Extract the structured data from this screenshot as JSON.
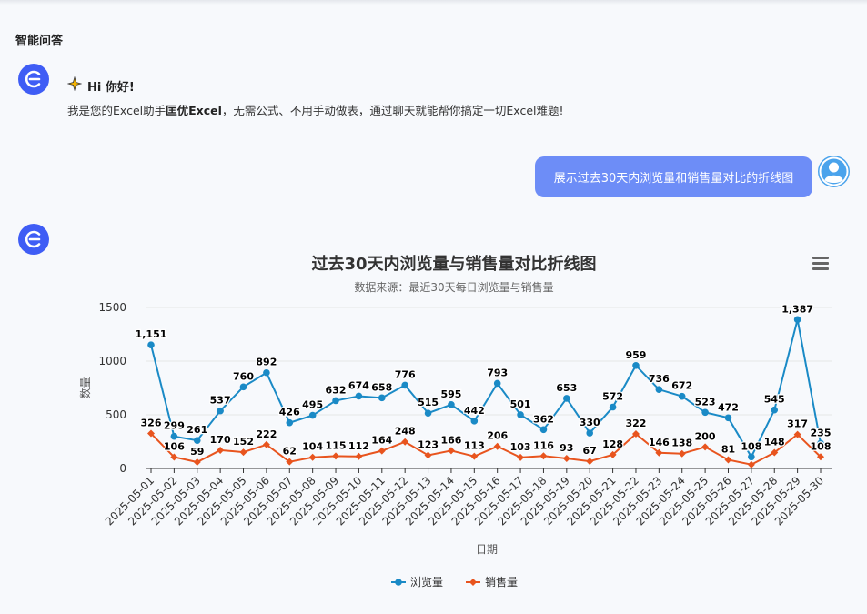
{
  "section": {
    "title": "智能问答"
  },
  "greeting": {
    "title": "Hi 你好!",
    "text_prefix": "我是您的Excel助手",
    "text_bold": "匡优Excel",
    "text_suffix": "，无需公式、不用手动做表，通过聊天就能帮你搞定一切Excel难题!"
  },
  "user_message": {
    "text": "展示过去30天内浏览量和销售量对比的折线图"
  },
  "colors": {
    "accent": "#3f5df5",
    "bubble": "#6d8df7",
    "series_views": "#1a8ac6",
    "series_sales": "#e8541e"
  },
  "chart_data": {
    "type": "line",
    "title": "过去30天内浏览量与销售量对比折线图",
    "subtitle": "数据来源：最近30天每日浏览量与销售量",
    "xlabel": "日期",
    "ylabel": "数量",
    "ylim": [
      0,
      1500
    ],
    "yticks": [
      "0",
      "500",
      "1000",
      "1500"
    ],
    "grid": true,
    "legend_position": "bottom-center",
    "categories": [
      "2025-05-01",
      "2025-05-02",
      "2025-05-03",
      "2025-05-04",
      "2025-05-05",
      "2025-05-06",
      "2025-05-07",
      "2025-05-08",
      "2025-05-09",
      "2025-05-10",
      "2025-05-11",
      "2025-05-12",
      "2025-05-13",
      "2025-05-14",
      "2025-05-15",
      "2025-05-16",
      "2025-05-17",
      "2025-05-18",
      "2025-05-19",
      "2025-05-20",
      "2025-05-21",
      "2025-05-22",
      "2025-05-23",
      "2025-05-24",
      "2025-05-25",
      "2025-05-26",
      "2025-05-27",
      "2025-05-28",
      "2025-05-29",
      "2025-05-30"
    ],
    "series": [
      {
        "name": "浏览量",
        "color": "#1a8ac6",
        "marker": "circle",
        "values": [
          1151,
          299,
          261,
          537,
          760,
          892,
          426,
          495,
          632,
          674,
          658,
          776,
          515,
          595,
          442,
          793,
          501,
          362,
          653,
          330,
          572,
          959,
          736,
          672,
          523,
          472,
          108,
          545,
          1387,
          235
        ],
        "labels": [
          "1,151",
          "299",
          "261",
          "537",
          "760",
          "892",
          "426",
          "495",
          "632",
          "674",
          "658",
          "776",
          "515",
          "595",
          "442",
          "793",
          "501",
          "362",
          "653",
          "330",
          "572",
          "959",
          "736",
          "672",
          "523",
          "472",
          "108",
          "545",
          "1,387",
          "235"
        ]
      },
      {
        "name": "销售量",
        "color": "#e8541e",
        "marker": "diamond",
        "values": [
          326,
          106,
          59,
          170,
          152,
          222,
          62,
          104,
          115,
          112,
          164,
          248,
          123,
          166,
          113,
          206,
          103,
          116,
          93,
          67,
          128,
          322,
          146,
          138,
          200,
          81,
          36,
          148,
          317,
          108
        ],
        "labels": [
          "326",
          "106",
          "59",
          "170",
          "152",
          "222",
          "62",
          "104",
          "115",
          "112",
          "164",
          "248",
          "123",
          "166",
          "113",
          "206",
          "103",
          "116",
          "93",
          "67",
          "128",
          "322",
          "146",
          "138",
          "200",
          "81",
          "",
          "148",
          "317",
          "108"
        ]
      }
    ]
  }
}
